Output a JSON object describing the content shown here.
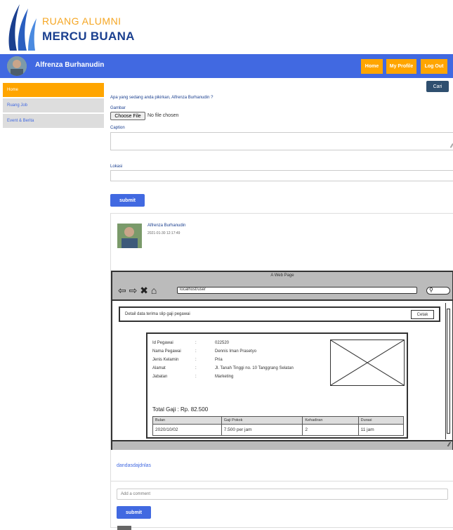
{
  "brand": {
    "line1": "RUANG ALUMNI",
    "line2": "MERCU BUANA"
  },
  "topbar": {
    "user_name": "Alfrenza Burhanudin",
    "home": "Home",
    "my_profile": "My Profile",
    "logout": "Log Out"
  },
  "sidebar": {
    "items": [
      {
        "label": "Home"
      },
      {
        "label": "Ruang Job"
      },
      {
        "label": "Event & Berita"
      }
    ]
  },
  "search_button": "Cari",
  "form": {
    "question": "Apa yang sedang anda pikirkan, Alfrenza Burhanudin ?",
    "gambar_label": "Gambar",
    "choose_file": "Choose File",
    "no_file": "No file chosen",
    "caption_label": "Caption",
    "lokasi_label": "Lokasi",
    "submit": "submit"
  },
  "post": {
    "author": "Alfrenza Burhanudin",
    "date": "2021-01-30 12:17:49",
    "mockup": {
      "window_title": "A Web Page",
      "url": "localhost/user",
      "header_text": "Detail data terima slip gaji pegawai",
      "cetak": "Cetak",
      "fields": [
        {
          "label": "Id Pegawai",
          "sep": ":",
          "value": "022520"
        },
        {
          "label": "Nama Pegawai",
          "sep": ":",
          "value": "Dennis Iman Prasetyo"
        },
        {
          "label": "Jenis Kelamin",
          "sep": ":",
          "value": "Pria"
        },
        {
          "label": "Alamat",
          "sep": ":",
          "value": "Jl. Tanah Tinggi no. 10 Tanggrang Selatan"
        },
        {
          "label": "Jabatan",
          "sep": ":",
          "value": "Marketing"
        }
      ],
      "total": "Total Gaji : Rp. 82.500",
      "table": {
        "headers": [
          "Bulan",
          "Gaji Pokok",
          "Kehadiran",
          "Durasi"
        ],
        "row": [
          "2020/10/02",
          "7.500 per jam",
          "2",
          "11 jam"
        ]
      }
    },
    "caption": "dandasdajdnlas",
    "comment_placeholder": "Add a comment",
    "comment_submit": "submit"
  }
}
